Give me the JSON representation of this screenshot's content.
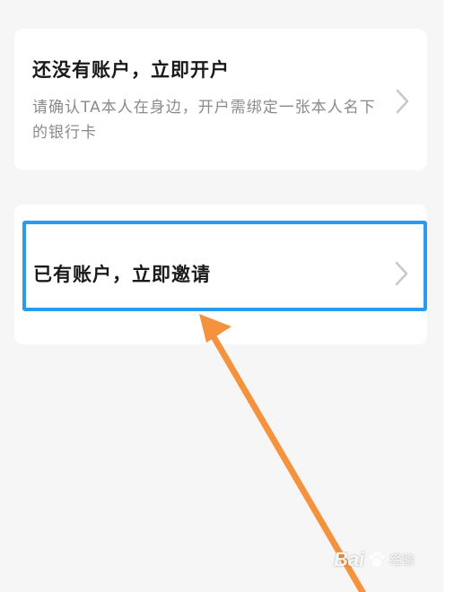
{
  "open_account_card": {
    "title": "还没有账户，立即开户",
    "description": "请确认TA本人在身边，开户需绑定一张本人名下的银行卡"
  },
  "invite_card": {
    "title": "已有账户，立即邀请"
  },
  "watermark": {
    "brand": "Bai",
    "brand_suffix": "经验"
  },
  "colors": {
    "highlight": "#2b9bef",
    "arrow": "#f5923e",
    "background": "#f6f6f6"
  }
}
